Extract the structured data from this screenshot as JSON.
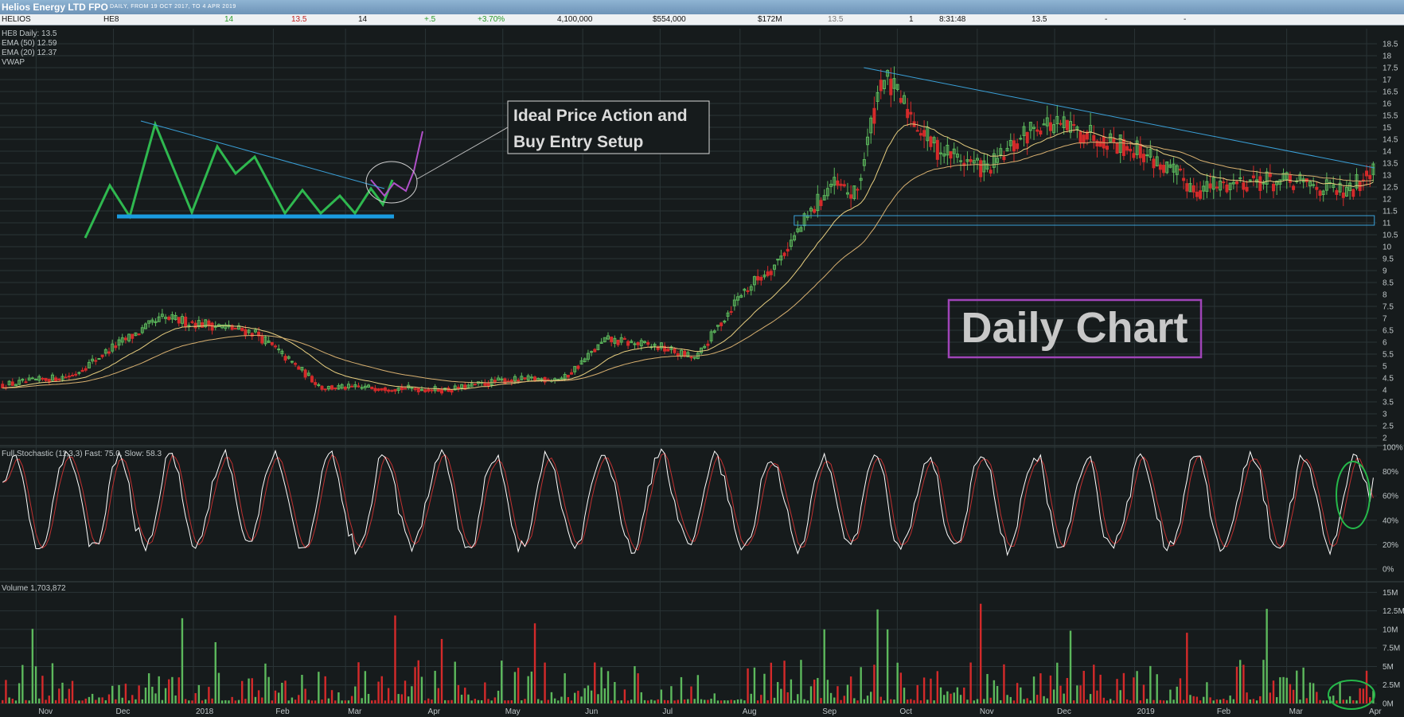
{
  "header": {
    "title": "Helios Energy LTD FPO",
    "subtitle": "DAILY, FROM 19 OCT 2017, TO 4 APR 2019"
  },
  "quote": {
    "name": "HELIOS",
    "code": "HE8",
    "bid": "14",
    "offer": "13.5",
    "last": "14",
    "change": "+.5",
    "pct_change": "+3.70%",
    "volume": "4,100,000",
    "value": "$554,000",
    "market_cap": "$172M",
    "open": "13.5",
    "trades": "1",
    "time": "8:31:48",
    "close": "13.5",
    "dash1": "-",
    "dash2": "-"
  },
  "colors": {
    "background": "#161b1c",
    "grid": "#2a3436",
    "up": "#5cb85c",
    "down": "#d42a2a",
    "ema_fast": "#e8cf80",
    "ema_slow": "#d8b070",
    "trendline": "#3aa0d8",
    "support": "#1a9be0",
    "pattern": "#2fb84f",
    "pattern_ext": "#b050c8",
    "stoch_fast": "#ffffff",
    "stoch_slow": "#c03030",
    "annotation_ring": "#25b84a"
  },
  "price_panel": {
    "legend": [
      "HE8 Daily: 13.5",
      "EMA (50) 12.59",
      "EMA (20) 12.37",
      "VWAP"
    ],
    "annotation_text": [
      "Ideal Price Action and",
      "Buy Entry Setup"
    ],
    "big_label": "Daily Chart"
  },
  "stoch_panel": {
    "label": "Full Stochastic (11,3,3) Fast: 75.0, Slow: 58.3"
  },
  "volume_panel": {
    "label": "Volume 1,703,872"
  },
  "chart_data": [
    {
      "type": "candlestick",
      "title": "HE8 Daily: 13.5",
      "x_labels": [
        "Nov",
        "Dec",
        "2018",
        "Feb",
        "Mar",
        "Apr",
        "May",
        "Jun",
        "Jul",
        "Aug",
        "Sep",
        "Oct",
        "Nov",
        "Dec",
        "2019",
        "Feb",
        "Mar",
        "Apr"
      ],
      "y_ticks": [
        "2",
        "2.5",
        "3",
        "3.5",
        "4",
        "4.5",
        "5",
        "5.5",
        "6",
        "6.5",
        "7",
        "7.5",
        "8",
        "8.5",
        "9",
        "9.5",
        "10",
        "10.5",
        "11",
        "11.5",
        "12",
        "12.5",
        "13",
        "13.5",
        "14",
        "14.5",
        "15",
        "15.5",
        "16",
        "16.5",
        "17",
        "17.5",
        "18",
        "18.5"
      ],
      "ylim": [
        1.8,
        18.8
      ],
      "approx_close": {
        "dates": [
          "2017-10-19",
          "2017-11-15",
          "2017-12-01",
          "2017-12-20",
          "2018-01-10",
          "2018-01-25",
          "2018-02-20",
          "2018-03-15",
          "2018-04-10",
          "2018-05-01",
          "2018-05-25",
          "2018-06-10",
          "2018-07-01",
          "2018-07-15",
          "2018-08-01",
          "2018-08-15",
          "2018-09-05",
          "2018-09-15",
          "2018-09-25",
          "2018-10-15",
          "2018-11-05",
          "2018-11-25",
          "2018-12-20",
          "2019-01-05",
          "2019-01-25",
          "2019-02-15",
          "2019-03-10",
          "2019-03-25",
          "2019-04-04"
        ],
        "values": [
          4.2,
          4.6,
          5.8,
          7.0,
          6.7,
          6.4,
          4.1,
          4.1,
          4.0,
          4.4,
          4.5,
          6.1,
          5.8,
          5.3,
          8.0,
          9.3,
          12.6,
          12.1,
          17.2,
          14.2,
          13.2,
          15.2,
          14.6,
          13.9,
          12.4,
          12.8,
          12.6,
          12.2,
          13.5
        ]
      },
      "trendline": {
        "from": [
          "2018-09-18",
          17.5
        ],
        "to": [
          "2019-04-04",
          13.3
        ]
      },
      "support_zone": [
        10.9,
        11.3
      ]
    },
    {
      "type": "line",
      "title": "Full Stochastic (11,3,3)",
      "y_ticks": [
        "0%",
        "20%",
        "40%",
        "60%",
        "80%",
        "100%"
      ],
      "ylim": [
        0,
        100
      ],
      "fast": 75.0,
      "slow": 58.3
    },
    {
      "type": "bar",
      "title": "Volume 1,703,872",
      "y_ticks": [
        "0M",
        "2.5M",
        "5M",
        "7.5M",
        "10M",
        "12.5M",
        "15M"
      ],
      "ylim": [
        0,
        16000000
      ],
      "last_value": 1703872
    }
  ]
}
